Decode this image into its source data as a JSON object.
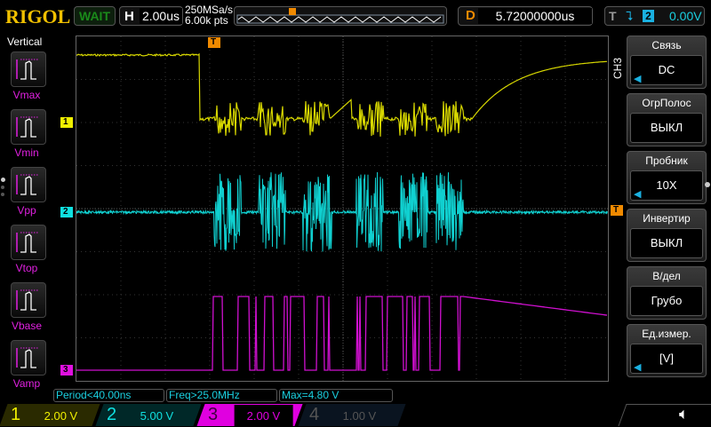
{
  "header": {
    "logo": "RIGOL",
    "status": "WAIT",
    "h_label": "H",
    "timebase": "2.00us",
    "sample_rate": "250MSa/s",
    "memory_depth": "6.00k pts",
    "d_label": "D",
    "delay": "5.72000000us",
    "t_label": "T",
    "trigger_source": "2",
    "trigger_level": "0.00V"
  },
  "sidebar": {
    "title": "Vertical",
    "items": [
      {
        "label": "Vmax"
      },
      {
        "label": "Vmin"
      },
      {
        "label": "Vpp"
      },
      {
        "label": "Vtop"
      },
      {
        "label": "Vbase"
      },
      {
        "label": "Vamp"
      }
    ]
  },
  "channel_markers": {
    "ch1": "1",
    "ch2": "2",
    "ch3": "3",
    "trigger": "T"
  },
  "menu": {
    "channel": "CH3",
    "items": [
      {
        "title": "Связь",
        "value": "DC"
      },
      {
        "title": "ОгрПолос",
        "value": "ВЫКЛ"
      },
      {
        "title": "Пробник",
        "value": "10X"
      },
      {
        "title": "Инвертир",
        "value": "ВЫКЛ"
      },
      {
        "title": "В/дел",
        "value": "Грубо"
      },
      {
        "title": "Ед.измер.",
        "value": "[V]"
      }
    ]
  },
  "measurements": [
    "Period<40.00ns",
    "Freq>25.0MHz",
    "Max=4.80 V"
  ],
  "channels": [
    {
      "num": "1",
      "scale": "2.00 V",
      "color": "#f0f000"
    },
    {
      "num": "2",
      "scale": "5.00 V",
      "color": "#00e0e0"
    },
    {
      "num": "3",
      "scale": "2.00 V",
      "color": "#e000e0"
    },
    {
      "num": "4",
      "scale": "1.00 V",
      "color": "#5080c0"
    }
  ],
  "colors": {
    "ch1": "#d8d800",
    "ch2": "#10d0d0",
    "ch3": "#d010d0",
    "trigger": "#f08a00"
  }
}
